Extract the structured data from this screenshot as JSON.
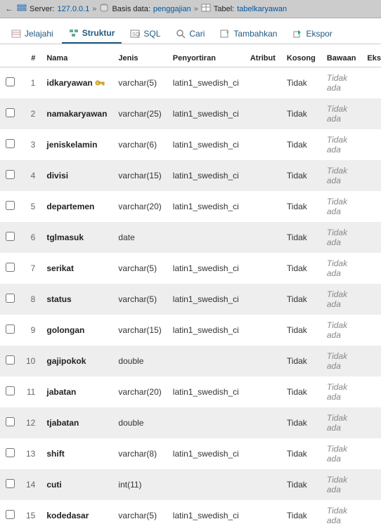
{
  "breadcrumb": {
    "server_label": "Server:",
    "server_value": "127.0.0.1",
    "db_label": "Basis data:",
    "db_value": "penggajian",
    "table_label": "Tabel:",
    "table_value": "tabelkaryawan"
  },
  "tabs": {
    "browse": "Jelajahi",
    "structure": "Struktur",
    "sql": "SQL",
    "search": "Cari",
    "insert": "Tambahkan",
    "export": "Ekspor"
  },
  "headers": {
    "num": "#",
    "nama": "Nama",
    "jenis": "Jenis",
    "penyortiran": "Penyortiran",
    "atribut": "Atribut",
    "kosong": "Kosong",
    "bawaan": "Bawaan",
    "ekstra": "Ekstr"
  },
  "rows": [
    {
      "n": "1",
      "nama": "idkaryawan",
      "key": true,
      "jenis": "varchar(5)",
      "sort": "latin1_swedish_ci",
      "kosong": "Tidak",
      "bawaan": "Tidak ada"
    },
    {
      "n": "2",
      "nama": "namakaryawan",
      "jenis": "varchar(25)",
      "sort": "latin1_swedish_ci",
      "kosong": "Tidak",
      "bawaan": "Tidak ada"
    },
    {
      "n": "3",
      "nama": "jeniskelamin",
      "jenis": "varchar(6)",
      "sort": "latin1_swedish_ci",
      "kosong": "Tidak",
      "bawaan": "Tidak ada"
    },
    {
      "n": "4",
      "nama": "divisi",
      "jenis": "varchar(15)",
      "sort": "latin1_swedish_ci",
      "kosong": "Tidak",
      "bawaan": "Tidak ada"
    },
    {
      "n": "5",
      "nama": "departemen",
      "jenis": "varchar(20)",
      "sort": "latin1_swedish_ci",
      "kosong": "Tidak",
      "bawaan": "Tidak ada"
    },
    {
      "n": "6",
      "nama": "tglmasuk",
      "jenis": "date",
      "sort": "",
      "kosong": "Tidak",
      "bawaan": "Tidak ada"
    },
    {
      "n": "7",
      "nama": "serikat",
      "jenis": "varchar(5)",
      "sort": "latin1_swedish_ci",
      "kosong": "Tidak",
      "bawaan": "Tidak ada"
    },
    {
      "n": "8",
      "nama": "status",
      "jenis": "varchar(5)",
      "sort": "latin1_swedish_ci",
      "kosong": "Tidak",
      "bawaan": "Tidak ada"
    },
    {
      "n": "9",
      "nama": "golongan",
      "jenis": "varchar(15)",
      "sort": "latin1_swedish_ci",
      "kosong": "Tidak",
      "bawaan": "Tidak ada"
    },
    {
      "n": "10",
      "nama": "gajipokok",
      "jenis": "double",
      "sort": "",
      "kosong": "Tidak",
      "bawaan": "Tidak ada"
    },
    {
      "n": "11",
      "nama": "jabatan",
      "jenis": "varchar(20)",
      "sort": "latin1_swedish_ci",
      "kosong": "Tidak",
      "bawaan": "Tidak ada"
    },
    {
      "n": "12",
      "nama": "tjabatan",
      "jenis": "double",
      "sort": "",
      "kosong": "Tidak",
      "bawaan": "Tidak ada"
    },
    {
      "n": "13",
      "nama": "shift",
      "jenis": "varchar(8)",
      "sort": "latin1_swedish_ci",
      "kosong": "Tidak",
      "bawaan": "Tidak ada"
    },
    {
      "n": "14",
      "nama": "cuti",
      "jenis": "int(11)",
      "sort": "",
      "kosong": "Tidak",
      "bawaan": "Tidak ada"
    },
    {
      "n": "15",
      "nama": "kodedasar",
      "jenis": "varchar(5)",
      "sort": "latin1_swedish_ci",
      "kosong": "Tidak",
      "bawaan": "Tidak ada"
    }
  ]
}
